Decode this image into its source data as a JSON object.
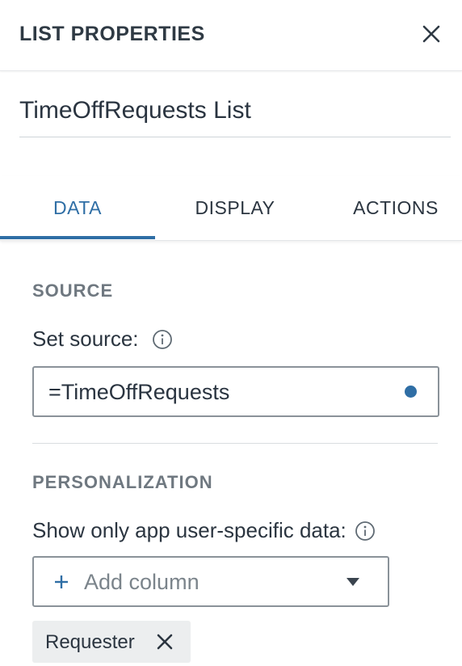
{
  "panel": {
    "title": "LIST PROPERTIES",
    "name_value": "TimeOffRequests List"
  },
  "tabs": [
    {
      "label": "DATA",
      "active": true
    },
    {
      "label": "DISPLAY",
      "active": false
    },
    {
      "label": "ACTIONS",
      "active": false
    }
  ],
  "source_section": {
    "heading": "SOURCE",
    "label": "Set source:",
    "value": "=TimeOffRequests"
  },
  "personalization_section": {
    "heading": "PERSONALIZATION",
    "label": "Show only app user-specific data:",
    "select_placeholder": "Add column",
    "chips": [
      {
        "label": "Requester"
      }
    ]
  },
  "icons": {
    "close": "close-icon",
    "info": "info-icon",
    "plus": "plus-icon",
    "dropdown": "caret-down-icon",
    "remove": "remove-icon"
  },
  "colors": {
    "accent": "#2f6ea5",
    "heading_gray": "#6f7880",
    "border": "#8a9299",
    "chip_bg": "#eceeef"
  }
}
